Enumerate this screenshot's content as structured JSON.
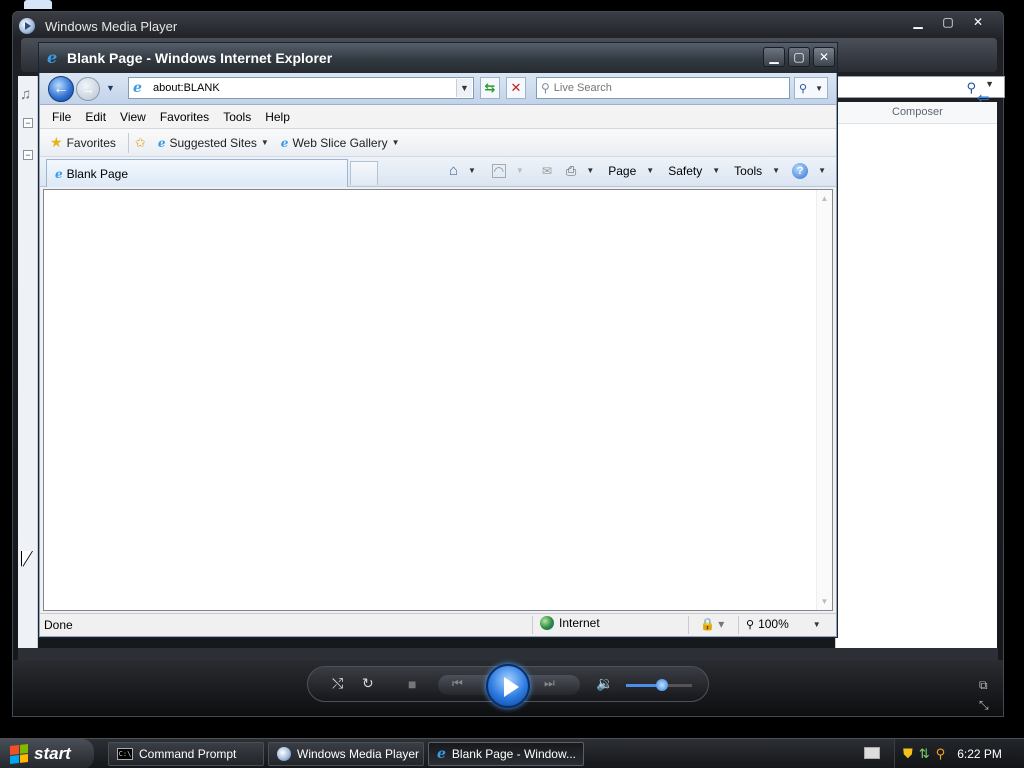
{
  "wmp": {
    "title": "Windows Media Player",
    "list_header": "Composer",
    "controls": [
      "minimize",
      "maximize",
      "close"
    ]
  },
  "ie": {
    "title": "Blank Page - Windows Internet Explorer",
    "address": "about:BLANK",
    "search_placeholder": "Live Search",
    "menu": [
      "File",
      "Edit",
      "View",
      "Favorites",
      "Tools",
      "Help"
    ],
    "favorites_label": "Favorites",
    "favbar_items": [
      "Suggested Sites",
      "Web Slice Gallery"
    ],
    "tab_label": "Blank Page",
    "cmd": {
      "page": "Page",
      "safety": "Safety",
      "tools": "Tools"
    },
    "status": {
      "text": "Done",
      "zone": "Internet",
      "zoom": "100%"
    }
  },
  "taskbar": {
    "start": "start",
    "tasks": [
      {
        "label": "Command Prompt"
      },
      {
        "label": "Windows Media Player"
      },
      {
        "label": "Blank Page - Window..."
      }
    ],
    "clock": "6:22 PM"
  },
  "colors": {
    "accent": "#2c6fd0",
    "title_bar": "#323940",
    "taskbar": "#1e2024"
  }
}
